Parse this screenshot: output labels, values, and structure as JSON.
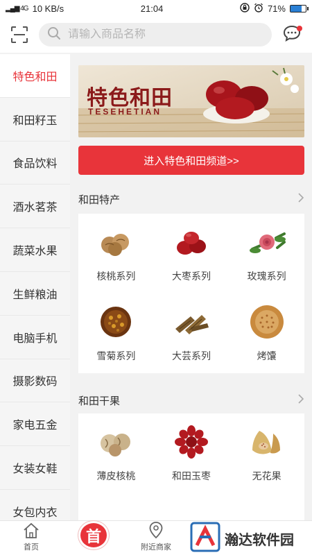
{
  "status_bar": {
    "signal": "▂▄▆ 4G",
    "speed": "10 KB/s",
    "time": "21:04",
    "battery": "71%",
    "battery_level": 0.71
  },
  "search": {
    "placeholder": "请输入商品名称"
  },
  "sidebar": {
    "items": [
      {
        "label": "特色和田"
      },
      {
        "label": "和田籽玉"
      },
      {
        "label": "食品饮料"
      },
      {
        "label": "酒水茗茶"
      },
      {
        "label": "蔬菜水果"
      },
      {
        "label": "生鲜粮油"
      },
      {
        "label": "电脑手机"
      },
      {
        "label": "摄影数码"
      },
      {
        "label": "家电五金"
      },
      {
        "label": "女装女鞋"
      },
      {
        "label": "女包内衣"
      }
    ]
  },
  "banner": {
    "title": "特色和田",
    "subtitle": "TESEHETIAN"
  },
  "enter_button": "进入特色和田频道>>",
  "sections": [
    {
      "title": "和田特产",
      "items": [
        {
          "label": "核桃系列",
          "icon": "walnut-icon"
        },
        {
          "label": "大枣系列",
          "icon": "jujube-icon"
        },
        {
          "label": "玫瑰系列",
          "icon": "rose-icon"
        },
        {
          "label": "雪菊系列",
          "icon": "snow-chrysanthemum-icon"
        },
        {
          "label": "大芸系列",
          "icon": "cistanche-icon"
        },
        {
          "label": "烤馕",
          "icon": "naan-icon"
        }
      ]
    },
    {
      "title": "和田干果",
      "items": [
        {
          "label": "薄皮核桃",
          "icon": "thin-walnut-icon"
        },
        {
          "label": "和田玉枣",
          "icon": "jade-jujube-icon"
        },
        {
          "label": "无花果",
          "icon": "fig-icon"
        }
      ]
    }
  ],
  "bottom_nav": {
    "home": "首页",
    "home_badge": "首",
    "nearby": "附近商家"
  },
  "watermark": "瀚达软件园",
  "colors": {
    "accent": "#e8343a"
  }
}
